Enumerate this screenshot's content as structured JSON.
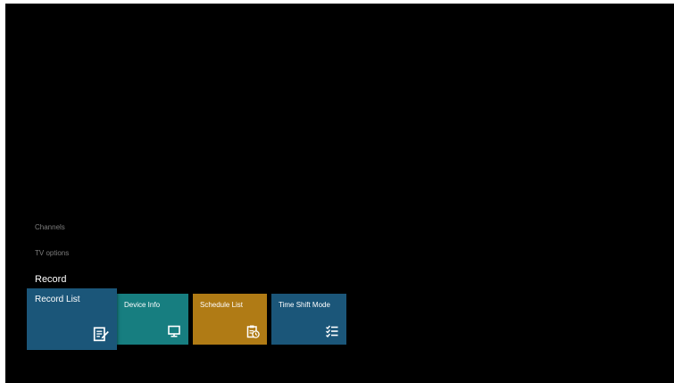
{
  "menu": {
    "channels": "Channels",
    "tv_options": "TV options",
    "record": "Record"
  },
  "cards": [
    {
      "label": "Record List",
      "icon": "record-list-icon",
      "color": "#1b5679",
      "selected": true
    },
    {
      "label": "Device Info",
      "icon": "monitor-icon",
      "color": "#177e80",
      "selected": false
    },
    {
      "label": "Schedule List",
      "icon": "schedule-clipboard-icon",
      "color": "#b07b15",
      "selected": false
    },
    {
      "label": "Time Shift Mode",
      "icon": "checklist-icon",
      "color": "#1b5679",
      "selected": false
    }
  ]
}
